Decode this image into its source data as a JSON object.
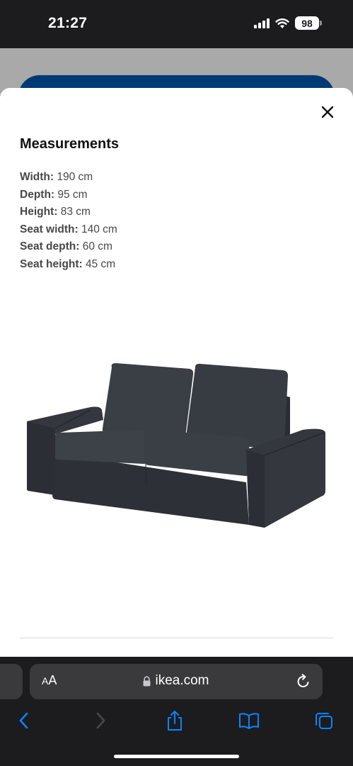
{
  "status_bar": {
    "time": "21:27",
    "battery": "98",
    "icons": [
      "cellular-signal-icon",
      "wifi-icon",
      "battery-icon"
    ]
  },
  "sheet": {
    "close_icon": "close-icon",
    "title": "Measurements",
    "measurements": [
      {
        "label": "Width:",
        "value": " 190 cm"
      },
      {
        "label": "Depth:",
        "value": " 95 cm"
      },
      {
        "label": "Height:",
        "value": " 83 cm"
      },
      {
        "label": "Seat width:",
        "value": " 140 cm"
      },
      {
        "label": "Seat depth:",
        "value": " 60 cm"
      },
      {
        "label": "Seat height:",
        "value": " 45 cm"
      }
    ],
    "image": "two-seat-sofa-dark-grey"
  },
  "browser": {
    "aa_big": "A",
    "aa_small_prefix": "A",
    "url": "ikea.com",
    "lock_icon": "lock-icon",
    "reload_icon": "reload-icon",
    "toolbar": [
      "back-icon",
      "forward-icon",
      "share-icon",
      "bookmarks-icon",
      "tabs-icon"
    ]
  },
  "colors": {
    "brand_blue": "#003a75",
    "accent": "#0a84ff",
    "chrome": "#1c1c1e"
  }
}
